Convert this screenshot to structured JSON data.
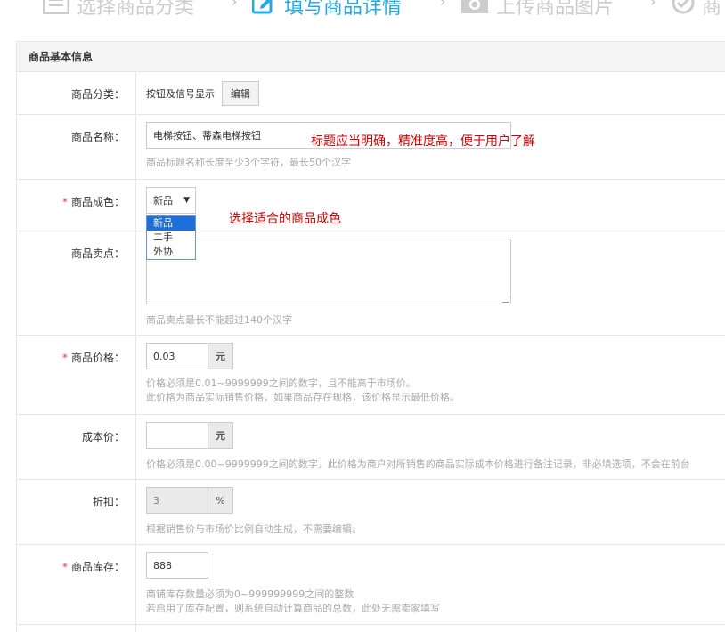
{
  "steps": [
    {
      "label": "选择商品分类",
      "icon": "list-icon"
    },
    {
      "label": "填写商品详情",
      "icon": "edit-icon",
      "active": true
    },
    {
      "label": "上传商品图片",
      "icon": "camera-icon"
    },
    {
      "label": "商",
      "icon": "check-circle-icon"
    }
  ],
  "panel": {
    "title": "商品基本信息"
  },
  "category": {
    "label": "商品分类：",
    "value": "按钮及信号显示",
    "edit_label": "编辑"
  },
  "name": {
    "label": "商品名称：",
    "value": "电梯按钮、蒂森电梯按钮",
    "hint": "商品标题名称长度至少3个字符，最长50个汉字",
    "note": "标题应当明确，精准度高，便于用户了解"
  },
  "condition": {
    "label": "商品成色：",
    "required": "*",
    "selected": "新品",
    "options": [
      "新品",
      "二手",
      "外协"
    ],
    "note": "选择适合的商品成色"
  },
  "selling_point": {
    "label": "商品卖点：",
    "hint": "商品卖点最长不能超过140个汉字"
  },
  "price": {
    "label": "商品价格：",
    "required": "*",
    "value": "0.03",
    "unit": "元",
    "hint1": "价格必须是0.01~9999999之间的数字，且不能高于市场价。",
    "hint2": "此价格为商品实际销售价格，如果商品存在规格，该价格显示最低价格。"
  },
  "cost": {
    "label": "成本价：",
    "value": "",
    "unit": "元",
    "hint": "价格必须是0.00~9999999之间的数字，此价格为商户对所销售的商品实际成本价格进行备注记录，非必填选项，不会在前台"
  },
  "discount": {
    "label": "折扣：",
    "value": "3",
    "unit": "%",
    "hint": "根据销售价与市场价比例自动生成，不需要编辑。"
  },
  "stock": {
    "label": "商品库存：",
    "required": "*",
    "value": "888",
    "hint1": "商铺库存数量必须为0~999999999之间的整数",
    "hint2": "若启用了库存配置，则系统自动计算商品的总数，此处无需卖家填写"
  }
}
